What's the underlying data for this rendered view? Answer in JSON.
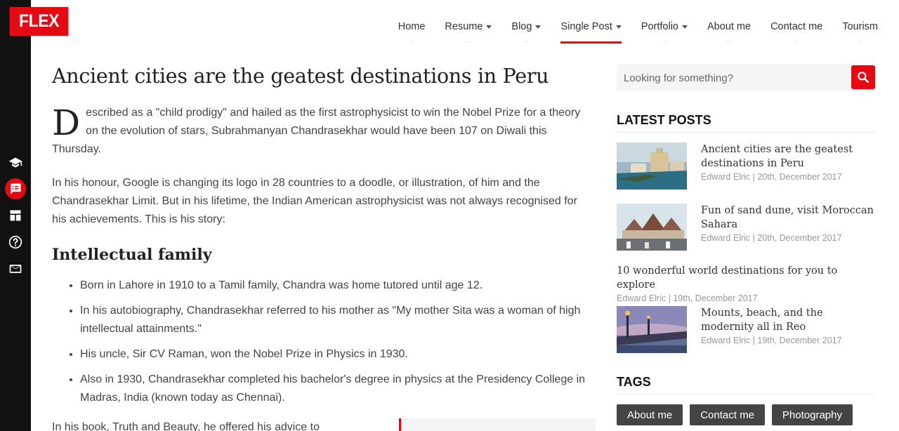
{
  "logo": "FLEX",
  "nav": [
    {
      "label": "Home",
      "dropdown": false,
      "active": false
    },
    {
      "label": "Resume",
      "dropdown": true,
      "active": false
    },
    {
      "label": "Blog",
      "dropdown": true,
      "active": false
    },
    {
      "label": "Single Post",
      "dropdown": true,
      "active": true
    },
    {
      "label": "Portfolio",
      "dropdown": true,
      "active": false
    },
    {
      "label": "About me",
      "dropdown": false,
      "active": false
    },
    {
      "label": "Contact me",
      "dropdown": false,
      "active": false
    },
    {
      "label": "Tourism",
      "dropdown": false,
      "active": false
    }
  ],
  "rail_icons": [
    "graduation-cap-icon",
    "posts-icon",
    "portfolio-grid-icon",
    "help-icon",
    "mail-icon"
  ],
  "article": {
    "title": "Ancient cities are the geatest destinations in Peru",
    "dropcap": "D",
    "para1": "escribed as a \"child prodigy\" and hailed as the first astrophysicist to win the Nobel Prize for a theory on the evolution of stars, Subrahmanyan Chandrasekhar would have been 107 on Diwali this Thursday.",
    "para2": "In his honour, Google is changing its logo in 28 countries to a doodle, or illustration, of him and the Chandrasekhar Limit. But in his lifetime, the Indian American astrophysicist was not always recognised for his achievements. This is his story:",
    "section_title": "Intellectual family",
    "bullets": [
      "Born in Lahore in 1910 to a Tamil family, Chandra was home tutored until age 12.",
      "In his autobiography, Chandrasekhar referred to his mother as \"My mother Sita was a woman of high intellectual attainments.\"",
      "His uncle, Sir CV Raman, won the Nobel Prize in Physics in 1930.",
      "Also in 1930, Chandrasekhar completed his bachelor's degree in physics at the Presidency College in Madras, India (known today as Chennai)."
    ],
    "tail": "In his book, Truth and Beauty, he offered his advice to"
  },
  "search": {
    "placeholder": "Looking for something?"
  },
  "latest_posts": {
    "title": "LATEST POSTS",
    "items": [
      {
        "title": "Ancient cities are the geatest destinations in Peru",
        "meta": "Edward Elric | 20th, December 2017",
        "thumb": "coastal-city"
      },
      {
        "title": "Fun of sand dune, visit Moroccan Sahara",
        "meta": "Edward Elric | 20th, December 2017",
        "thumb": "temple"
      },
      {
        "title": "10 wonderful world destinations for you to explore",
        "meta": "Edward Elric | 19th, December 2017",
        "thumb": ""
      },
      {
        "title": "Mounts, beach, and the modernity all in Reo",
        "meta": "Edward Elric | 19th, December 2017",
        "thumb": "bridge-dusk"
      }
    ]
  },
  "tags": {
    "title": "TAGS",
    "items": [
      "About me",
      "Contact me",
      "Photography"
    ]
  }
}
